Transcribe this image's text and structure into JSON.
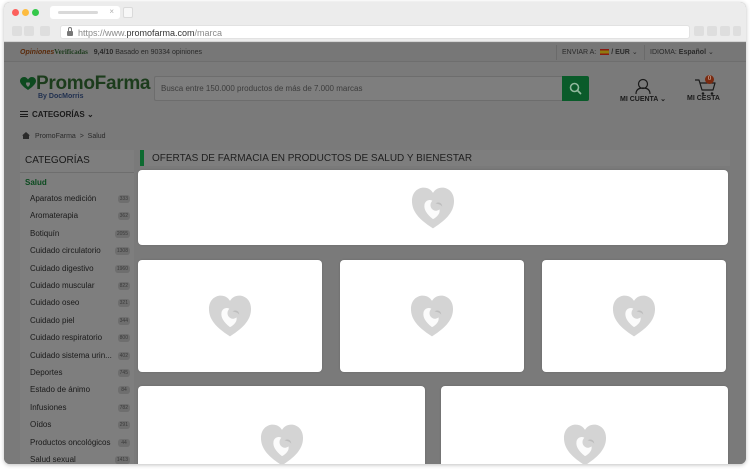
{
  "browser": {
    "url_prefix": "https://www.",
    "url_domain": "promofarma.com",
    "url_path": "/marca"
  },
  "topbar": {
    "rating_brand_1": "Opiniones",
    "rating_brand_2": "Verificadas",
    "rating_score": "9,4/10",
    "rating_text": "Basado en 90334 opiniones",
    "ship_label": "ENVIAR A:",
    "currency": "/ EUR",
    "language_label": "IDIOMA:",
    "language_value": "Español"
  },
  "header": {
    "logo_text": "PromoFarma",
    "logo_sub": "By DocMorris",
    "search_placeholder": "Busca entre 150.000 productos de más de 7.000 marcas",
    "account_label": "MI CUENTA",
    "cart_label": "MI CESTA",
    "cart_count": "0",
    "categories_menu": "CATEGORÍAS"
  },
  "breadcrumb": {
    "home": "PromoFarma",
    "separator": ">",
    "current": "Salud"
  },
  "sidebar": {
    "title": "CATEGORÍAS",
    "active": "Salud",
    "items": [
      {
        "label": "Aparatos medición",
        "count": "333"
      },
      {
        "label": "Aromaterapia",
        "count": "362"
      },
      {
        "label": "Botiquín",
        "count": "2055"
      },
      {
        "label": "Cuidado circulatorio",
        "count": "1308"
      },
      {
        "label": "Cuidado digestivo",
        "count": "1960"
      },
      {
        "label": "Cuidado muscular",
        "count": "822"
      },
      {
        "label": "Cuidado oseo",
        "count": "321"
      },
      {
        "label": "Cuidado piel",
        "count": "344"
      },
      {
        "label": "Cuidado respiratorio",
        "count": "800"
      },
      {
        "label": "Cuidado sistema urin...",
        "count": "402"
      },
      {
        "label": "Deportes",
        "count": "745"
      },
      {
        "label": "Estado de ánimo",
        "count": "84"
      },
      {
        "label": "Infusiones",
        "count": "782"
      },
      {
        "label": "Oídos",
        "count": "291"
      },
      {
        "label": "Productos oncológicos",
        "count": "44"
      },
      {
        "label": "Salud sexual",
        "count": "1413"
      }
    ]
  },
  "main": {
    "title": "OFERTAS DE FARMACIA EN PRODUCTOS DE SALUD Y BIENESTAR"
  },
  "colors": {
    "brand_green": "#009a3e",
    "placeholder_heart": "#d4d4d4"
  },
  "icons": {
    "card_placeholder": "promofarma-heart-icon"
  }
}
